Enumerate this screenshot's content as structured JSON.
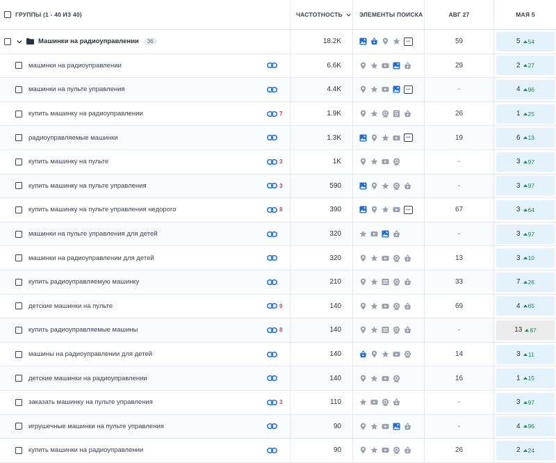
{
  "header": {
    "groups_label": "ГРУППЫ (1 - 40 ИЗ 40)",
    "volume_label": "ЧАСТОТНОСТЬ",
    "features_label": "ЭЛЕМЕНТЫ ПОИСКА",
    "aug_label": "АВГ 27",
    "may_label": "МАЯ 5"
  },
  "group": {
    "name": "Машинки на радиоуправлении",
    "count": "36",
    "volume": "18.2K",
    "features": [
      "image",
      "shopping",
      "location",
      "star",
      "more"
    ],
    "aug": "59",
    "may_pos": "5",
    "may_delta": "54"
  },
  "colors": {
    "accent_blue": "#1e6fd9",
    "gray_icon": "#9aa0ad",
    "link_red": "#e03a3a",
    "delta_green": "#1a8a5a",
    "rank_bg": "#e4f2fb"
  },
  "rows": [
    {
      "keyword": "машинки на радиоуправлении",
      "link_count": "",
      "volume": "6.6K",
      "features": [
        "location",
        "star",
        "video",
        "image",
        "shopping-gray"
      ],
      "aug": "29",
      "may_pos": "2",
      "may_delta": "27",
      "gray": false
    },
    {
      "keyword": "машинки на пульте управления",
      "link_count": "",
      "volume": "4.4K",
      "features": [
        "location",
        "star",
        "video",
        "image",
        "more"
      ],
      "aug": "-",
      "may_pos": "4",
      "may_delta": "96",
      "gray": false
    },
    {
      "keyword": "купить машинку на радиоуправлении",
      "link_count": "7",
      "volume": "1.9K",
      "features": [
        "location",
        "star",
        "review",
        "review2",
        "shopping-gray"
      ],
      "aug": "26",
      "may_pos": "1",
      "may_delta": "25",
      "gray": false
    },
    {
      "keyword": "радиоуправляемые машинки",
      "link_count": "",
      "volume": "1.3K",
      "features": [
        "image",
        "location",
        "star",
        "video",
        "more"
      ],
      "aug": "19",
      "may_pos": "6",
      "may_delta": "13",
      "gray": false
    },
    {
      "keyword": "купить машинку на пульте",
      "link_count": "3",
      "volume": "1K",
      "features": [
        "location",
        "star",
        "video",
        "review"
      ],
      "aug": "-",
      "may_pos": "3",
      "may_delta": "97",
      "gray": false
    },
    {
      "keyword": "купить машинку на пульте управления",
      "link_count": "3",
      "volume": "590",
      "features": [
        "image",
        "location",
        "star",
        "review",
        "shopping-gray"
      ],
      "aug": "-",
      "may_pos": "3",
      "may_delta": "97",
      "gray": false
    },
    {
      "keyword": "купить машинку на пульте управления недорого",
      "link_count": "8",
      "volume": "390",
      "features": [
        "image",
        "location",
        "star",
        "video",
        "more"
      ],
      "aug": "67",
      "may_pos": "3",
      "may_delta": "64",
      "gray": false
    },
    {
      "keyword": "машинки на пульте управления для детей",
      "link_count": "",
      "volume": "320",
      "features": [
        "star",
        "video",
        "image",
        "shopping-gray"
      ],
      "aug": "-",
      "may_pos": "3",
      "may_delta": "97",
      "gray": false
    },
    {
      "keyword": "машинки на радиоуправлении для детей",
      "link_count": "",
      "volume": "320",
      "features": [
        "location",
        "star",
        "video",
        "review",
        "shopping-gray"
      ],
      "aug": "13",
      "may_pos": "3",
      "may_delta": "10",
      "gray": false
    },
    {
      "keyword": "купить радиоуправляемую машинку",
      "link_count": "",
      "volume": "210",
      "features": [
        "location",
        "star",
        "list",
        "review",
        "shopping-gray"
      ],
      "aug": "33",
      "may_pos": "7",
      "may_delta": "26",
      "gray": false
    },
    {
      "keyword": "детские машинки на пульте",
      "link_count": "9",
      "volume": "140",
      "features": [
        "location",
        "star",
        "video",
        "review",
        "shopping-gray"
      ],
      "aug": "69",
      "may_pos": "4",
      "may_delta": "65",
      "gray": false
    },
    {
      "keyword": "купить радиоуправляемые машины",
      "link_count": "8",
      "volume": "140",
      "features": [
        "location",
        "star",
        "list",
        "review",
        "shopping-gray"
      ],
      "aug": "-",
      "may_pos": "13",
      "may_delta": "87",
      "gray": true
    },
    {
      "keyword": "машины на радиоуправлении для детей",
      "link_count": "",
      "volume": "140",
      "features": [
        "shopping",
        "location",
        "star",
        "video",
        "review"
      ],
      "aug": "14",
      "may_pos": "3",
      "may_delta": "11",
      "gray": false
    },
    {
      "keyword": "детские машинки на радиоуправлении",
      "link_count": "",
      "volume": "140",
      "features": [
        "location",
        "star",
        "video",
        "review"
      ],
      "aug": "16",
      "may_pos": "1",
      "may_delta": "15",
      "gray": false
    },
    {
      "keyword": "заказать машинку на пульте управления",
      "link_count": "3",
      "volume": "110",
      "features": [
        "star",
        "video",
        "review",
        "shopping-gray"
      ],
      "aug": "-",
      "may_pos": "3",
      "may_delta": "97",
      "gray": false
    },
    {
      "keyword": "игрушечные машинки на пульте управления",
      "link_count": "",
      "volume": "90",
      "features": [
        "location",
        "star",
        "video",
        "image",
        "shopping-gray"
      ],
      "aug": "-",
      "may_pos": "4",
      "may_delta": "96",
      "gray": false
    },
    {
      "keyword": "купить машинки на радиоуправлении",
      "link_count": "",
      "volume": "90",
      "features": [
        "location",
        "star",
        "video",
        "review",
        "shopping-gray"
      ],
      "aug": "26",
      "may_pos": "2",
      "may_delta": "24",
      "gray": false
    }
  ]
}
